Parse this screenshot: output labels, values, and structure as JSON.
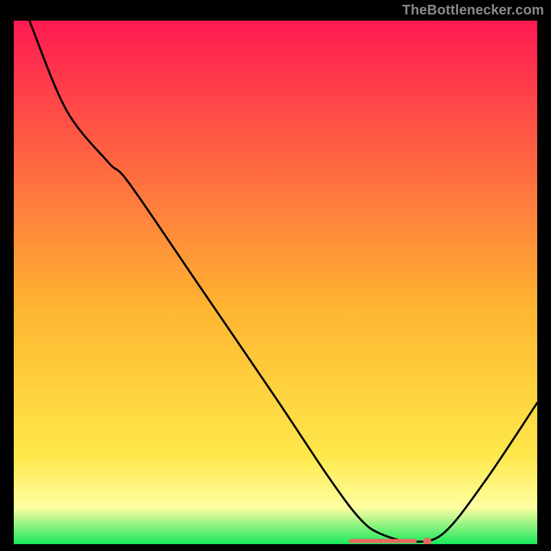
{
  "attribution": "TheBottlenecker.com",
  "colors": {
    "top": "#ff1a52",
    "mid": "#ffb531",
    "low": "#ffe84a",
    "band": "#fffea1",
    "bottom": "#18e85e",
    "line": "#000000",
    "marker": "#e66a5d",
    "bg": "#000000"
  },
  "chart_data": {
    "type": "line",
    "title": "",
    "xlabel": "",
    "ylabel": "",
    "xlim": [
      0,
      100
    ],
    "ylim": [
      0,
      100
    ],
    "series": [
      {
        "name": "curve",
        "points": [
          {
            "x": 3,
            "y": 100
          },
          {
            "x": 10,
            "y": 83
          },
          {
            "x": 18,
            "y": 73
          },
          {
            "x": 22,
            "y": 69
          },
          {
            "x": 35,
            "y": 50
          },
          {
            "x": 50,
            "y": 28
          },
          {
            "x": 60,
            "y": 13
          },
          {
            "x": 66,
            "y": 5
          },
          {
            "x": 70,
            "y": 2
          },
          {
            "x": 76,
            "y": 0.5
          },
          {
            "x": 82,
            "y": 2
          },
          {
            "x": 90,
            "y": 12
          },
          {
            "x": 100,
            "y": 27
          }
        ]
      }
    ],
    "marker": {
      "x": 79,
      "y": 0.5
    },
    "bar_segment": {
      "x_start": 64,
      "x_end": 77,
      "y": 0.6
    }
  }
}
